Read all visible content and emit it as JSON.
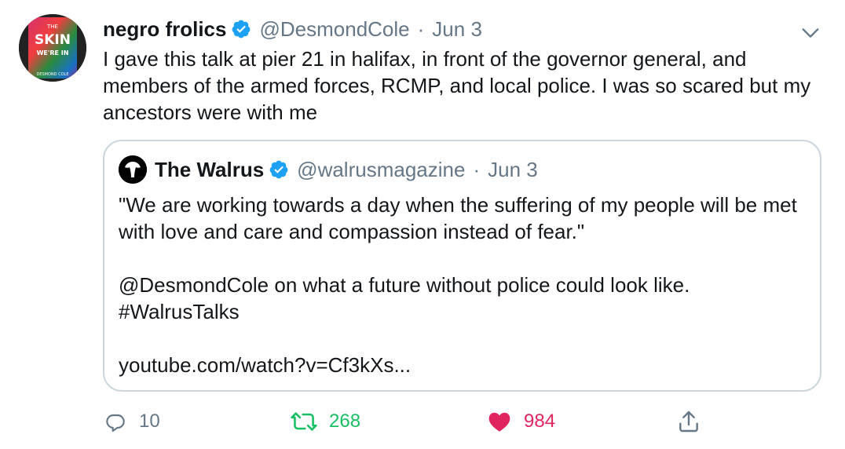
{
  "author": {
    "name": "negro frolics",
    "handle": "@DesmondCole",
    "date": "Jun 3",
    "avatar_text": [
      "THE",
      "SKIN",
      "WE'RE IN",
      "DESMOND COLE"
    ]
  },
  "tweet": {
    "text": "I gave this talk at pier 21 in halifax, in front of the governor general, and members of the armed forces, RCMP, and local police. I was so scared but my ancestors were with me"
  },
  "quoted": {
    "name": "The Walrus",
    "handle": "@walrusmagazine",
    "date": "Jun 3",
    "paragraphs": [
      "\"We are working towards a day when the suffering of my people will be met with love and care and compassion instead of fear.\"",
      "",
      "@DesmondCole on what a future without police could look like.",
      "#WalrusTalks",
      "",
      "youtube.com/watch?v=Cf3kXs..."
    ]
  },
  "actions": {
    "replies": "10",
    "retweets": "268",
    "likes": "984"
  },
  "colors": {
    "verified": "#1da1f2",
    "muted": "#657786",
    "retweet": "#17bf63",
    "like": "#e0245e",
    "border": "#ccd6dd"
  },
  "icons": [
    "verified-badge-icon",
    "chevron-down-icon",
    "reply-icon",
    "retweet-icon",
    "heart-icon",
    "share-icon",
    "walrus-logo-icon"
  ]
}
